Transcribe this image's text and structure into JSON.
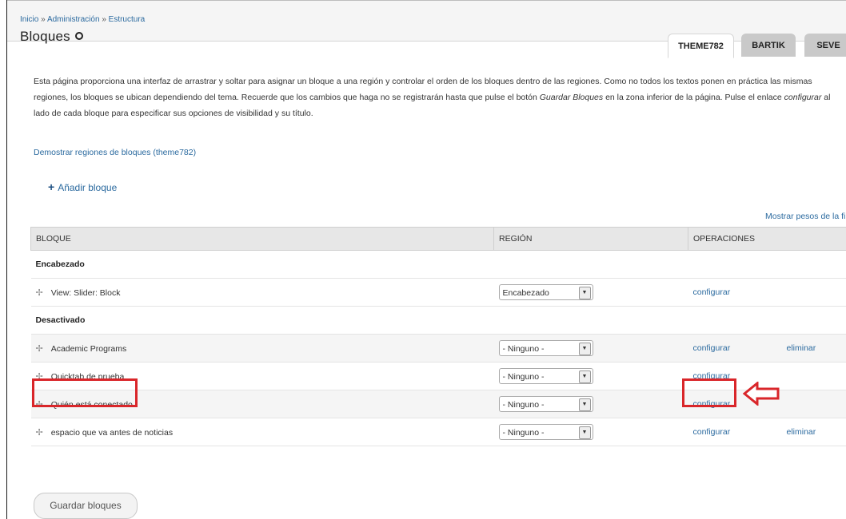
{
  "breadcrumb": [
    "Inicio",
    "Administración",
    "Estructura"
  ],
  "breadcrumb_sep": "»",
  "page_title": "Bloques",
  "tabs": [
    "THEME782",
    "BARTIK",
    "SEVE"
  ],
  "description": {
    "part1": "Esta página proporciona una interfaz de arrastrar y soltar para asignar un bloque a una región y controlar el orden de los bloques dentro de las regiones. Como no todos los textos ponen en práctica las mismas regiones, los bloques se ubican dependiendo del tema. Recuerde que los cambios que haga no se registrarán hasta que pulse el botón ",
    "em1": "Guardar Bloques",
    "part2": " en la zona inferior de la página. Pulse el enlace ",
    "em2": "configurar",
    "part3": " al lado de cada bloque para especificar sus opciones de visibilidad y su título."
  },
  "demo_link": "Demostrar regiones de bloques (theme782)",
  "add_block": "Añadir bloque",
  "show_weights": "Mostrar pesos de la fil",
  "table": {
    "headers": [
      "BLOQUE",
      "REGIÓN",
      "OPERACIONES"
    ],
    "regions": [
      {
        "title": "Encabezado",
        "rows": [
          {
            "name": "View: Slider: Block",
            "region": "Encabezado",
            "configure": "configurar",
            "delete": ""
          }
        ]
      },
      {
        "title": "Desactivado",
        "rows": [
          {
            "name": "Academic Programs",
            "region": "- Ninguno -",
            "configure": "configurar",
            "delete": "eliminar"
          },
          {
            "name": "Quicktab de prueba",
            "region": "- Ninguno -",
            "configure": "configurar",
            "delete": ""
          },
          {
            "name": "Quién está conectado",
            "region": "- Ninguno -",
            "configure": "configurar",
            "delete": ""
          },
          {
            "name": "espacio que va antes de noticias",
            "region": "- Ninguno -",
            "configure": "configurar",
            "delete": "eliminar"
          }
        ]
      }
    ]
  },
  "save_button": "Guardar bloques",
  "colors": {
    "link": "#2b6a9f",
    "annotation": "#d9262a",
    "header_bg": "#f5f5f5"
  }
}
